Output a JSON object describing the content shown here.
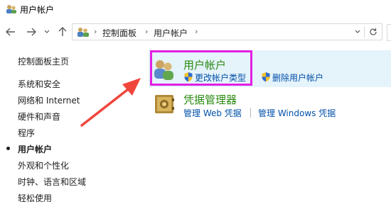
{
  "window": {
    "title": "用户帐户"
  },
  "address": {
    "crumbs": [
      "控制面板",
      "用户帐户"
    ]
  },
  "sidebar": {
    "home_label": "控制面板主页",
    "items": [
      {
        "label": "系统和安全",
        "active": false
      },
      {
        "label": "网络和 Internet",
        "active": false
      },
      {
        "label": "硬件和声音",
        "active": false
      },
      {
        "label": "程序",
        "active": false
      },
      {
        "label": "用户帐户",
        "active": true
      },
      {
        "label": "外观和个性化",
        "active": false
      },
      {
        "label": "时钟、语言和区域",
        "active": false
      },
      {
        "label": "轻松使用",
        "active": false
      }
    ]
  },
  "categories": [
    {
      "title": "用户帐户",
      "links": [
        "更改帐户类型",
        "删除用户帐户"
      ]
    },
    {
      "title": "凭据管理器",
      "links": [
        "管理 Web 凭据",
        "管理 Windows 凭据"
      ]
    }
  ],
  "colors": {
    "highlight": "#e5f3fb",
    "annotation": "#e21ee3",
    "arrow": "#f0463c",
    "link": "#0050a8",
    "category_title": "#2a8a10"
  }
}
